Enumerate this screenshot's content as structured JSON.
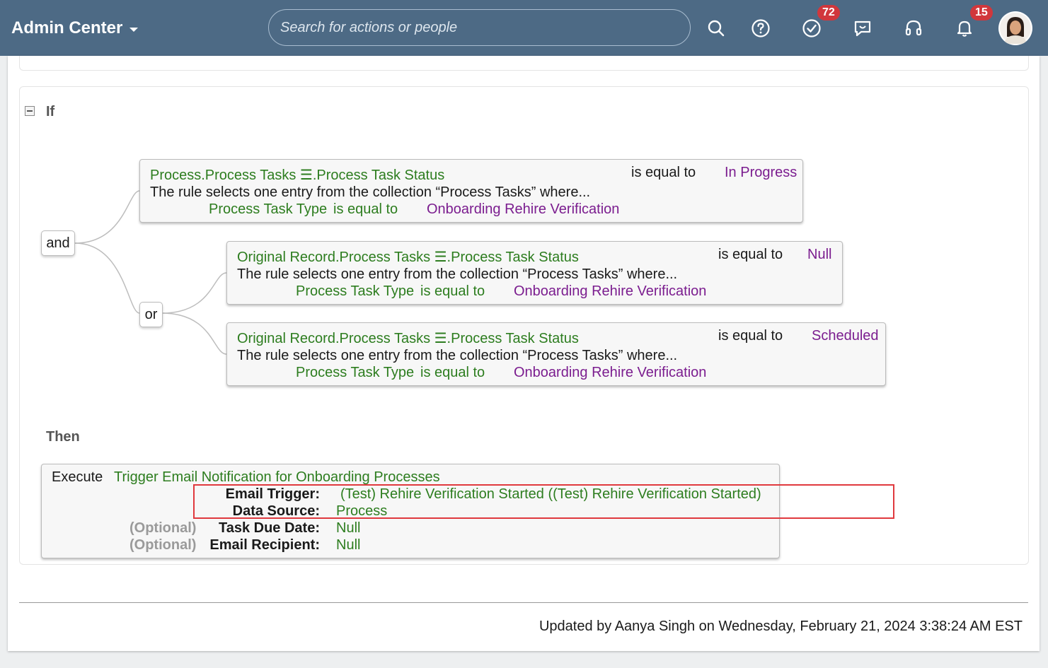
{
  "header": {
    "app_title": "Admin Center",
    "search_placeholder": "Search for actions or people",
    "todo_count": "72",
    "notification_count": "15",
    "bg_color": "#4d6a85"
  },
  "rule": {
    "if_label": "If",
    "then_label": "Then",
    "operators": {
      "and": "and",
      "or": "or"
    },
    "conditions": [
      {
        "field": "Process.Process Tasks ☰.Process Task Status",
        "operator": "is equal to",
        "value": "In Progress",
        "description": "The rule selects one entry from the collection “Process Tasks” where...",
        "sub_field": "Process Task Type",
        "sub_operator": "is equal to",
        "sub_value": "Onboarding Rehire Verification"
      },
      {
        "field": "Original Record.Process Tasks ☰.Process Task Status",
        "operator": "is equal to",
        "value": "Null",
        "description": "The rule selects one entry from the collection “Process Tasks” where...",
        "sub_field": "Process Task Type",
        "sub_operator": "is equal to",
        "sub_value": "Onboarding Rehire Verification"
      },
      {
        "field": "Original Record.Process Tasks ☰.Process Task Status",
        "operator": "is equal to",
        "value": "Scheduled",
        "description": "The rule selects one entry from the collection “Process Tasks” where...",
        "sub_field": "Process Task Type",
        "sub_operator": "is equal to",
        "sub_value": "Onboarding Rehire Verification"
      }
    ],
    "action": {
      "execute_label": "Execute",
      "function": "Trigger Email Notification for Onboarding Processes",
      "params": [
        {
          "optional": "",
          "name": "Email Trigger:",
          "value": "(Test) Rehire Verification Started ((Test) Rehire Verification Started)"
        },
        {
          "optional": "",
          "name": "Data Source:",
          "value": "Process"
        },
        {
          "optional": "(Optional)",
          "name": "Task Due Date:",
          "value": "Null"
        },
        {
          "optional": "(Optional)",
          "name": "Email Recipient:",
          "value": "Null"
        }
      ]
    }
  },
  "footer": {
    "updated_text": "Updated by Aanya Singh on Wednesday, February 21, 2024 3:38:24 AM EST"
  },
  "colors": {
    "field_green": "#2d7d1f",
    "value_purple": "#7b1d8f",
    "badge_red": "#d1373c",
    "highlight_red": "#e0393e"
  }
}
